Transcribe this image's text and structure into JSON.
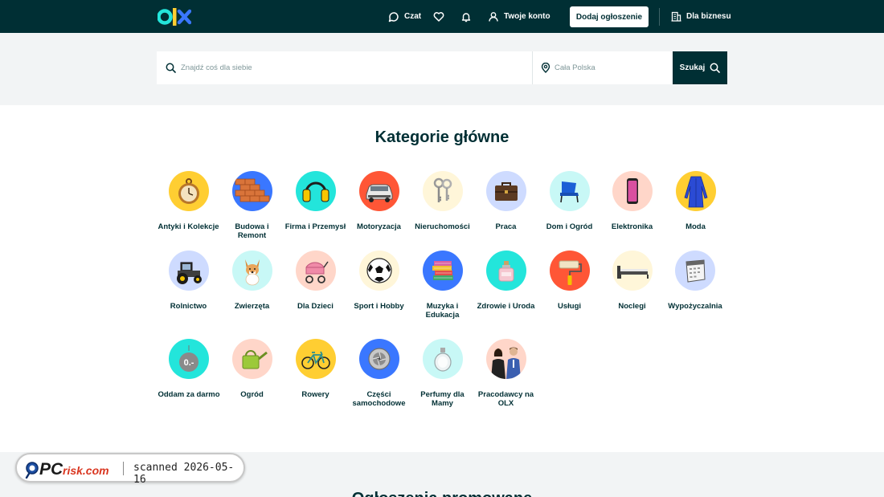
{
  "header": {
    "logo_alt": "olx",
    "chat_label": "Czat",
    "account_label": "Twoje konto",
    "add_ad_label": "Dodaj ogłoszenie",
    "business_label": "Dla biznesu",
    "icons": [
      "chat-icon",
      "heart-icon",
      "bell-icon",
      "user-icon",
      "building-icon"
    ]
  },
  "search": {
    "query_placeholder": "Znajdź coś dla siebie",
    "location_placeholder": "Cała Polska",
    "button_label": "Szukaj"
  },
  "categories": {
    "title": "Kategorie główne",
    "items": [
      {
        "label": "Antyki i Kolekcje",
        "icon": "pocket-watch-icon",
        "bg": "#ffce32"
      },
      {
        "label": "Budowa i Remont",
        "icon": "bricks-icon",
        "bg": "#3a77ff"
      },
      {
        "label": "Firma i Przemysł",
        "icon": "ear-protectors-icon",
        "bg": "#23e5db"
      },
      {
        "label": "Motoryzacja",
        "icon": "car-icon",
        "bg": "#ff5636"
      },
      {
        "label": "Nieruchomości",
        "icon": "keys-icon",
        "bg": "#fff6d9"
      },
      {
        "label": "Praca",
        "icon": "briefcase-icon",
        "bg": "#cedbff"
      },
      {
        "label": "Dom i Ogród",
        "icon": "armchair-icon",
        "bg": "#c8f8f6"
      },
      {
        "label": "Elektronika",
        "icon": "smartphone-icon",
        "bg": "#ffd6c9"
      },
      {
        "label": "Moda",
        "icon": "dress-icon",
        "bg": "#ffce32"
      },
      {
        "label": "Rolnictwo",
        "icon": "tractor-icon",
        "bg": "#cedbff"
      },
      {
        "label": "Zwierzęta",
        "icon": "dog-icon",
        "bg": "#c8f8f6"
      },
      {
        "label": "Dla Dzieci",
        "icon": "stroller-icon",
        "bg": "#ffd6c9"
      },
      {
        "label": "Sport i Hobby",
        "icon": "football-icon",
        "bg": "#fff6d9"
      },
      {
        "label": "Muzyka i Edukacja",
        "icon": "books-icon",
        "bg": "#3a77ff"
      },
      {
        "label": "Zdrowie i Uroda",
        "icon": "perfume-bottle-icon",
        "bg": "#23e5db"
      },
      {
        "label": "Usługi",
        "icon": "paint-roller-icon",
        "bg": "#ff5636"
      },
      {
        "label": "Noclegi",
        "icon": "bed-icon",
        "bg": "#fff6d9"
      },
      {
        "label": "Wypożyczalnia",
        "icon": "calendar-icon",
        "bg": "#cedbff"
      },
      {
        "label": "Oddam za darmo",
        "icon": "free-tag-icon",
        "bg": "#23e5db"
      },
      {
        "label": "Ogród",
        "icon": "watering-can-icon",
        "bg": "#ffd6c9"
      },
      {
        "label": "Rowery",
        "icon": "bicycle-icon",
        "bg": "#ffce32"
      },
      {
        "label": "Części samochodowe",
        "icon": "turbocharger-icon",
        "bg": "#3a77ff"
      },
      {
        "label": "Perfumy dla Mamy",
        "icon": "perfume-icon",
        "bg": "#c8f8f6"
      },
      {
        "label": "Pracodawcy na OLX",
        "icon": "employers-icon",
        "bg": "#ffd6c9"
      }
    ]
  },
  "promoted": {
    "title": "Ogłoszenia promowane"
  },
  "watermark": {
    "brand": "PCrisk.com",
    "scan_text": "scanned 2026-05-16"
  },
  "colors": {
    "brand_dark": "#002f34",
    "background_light": "#f2f4f5",
    "white": "#ffffff"
  }
}
